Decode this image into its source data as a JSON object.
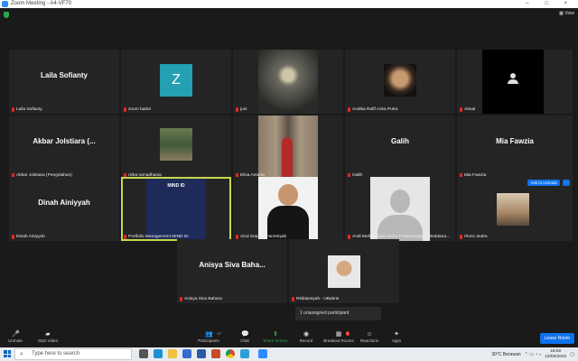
{
  "window": {
    "title": "Zoom Meeting - A4-VF70",
    "controls": "–  □  ×"
  },
  "meeting": {
    "view_label": "▦ View"
  },
  "tiles": [
    {
      "name": "Laila Sofianty",
      "caption": "Laila Sofianty"
    },
    {
      "caption": "zoom bat04",
      "avatar_letter": "Z"
    },
    {
      "caption": "juni"
    },
    {
      "caption": "Andika Rafif Azka Putra"
    },
    {
      "caption": "Atmal"
    },
    {
      "name": "Akbar Jolstiara (...",
      "caption": "Akbar Jolstiara (Pengolahan)"
    },
    {
      "caption": "rizka ramadhania"
    },
    {
      "caption": "Elisa Antarta"
    },
    {
      "name": "Galih",
      "caption": "Galih"
    },
    {
      "name": "Mia Fawzia",
      "caption": "Mia Fawzia"
    },
    {
      "name": "Dinah Ainiyyah",
      "caption": "Dinah Ainiyyah"
    },
    {
      "caption": "Portfolio Management MIND ID",
      "logo_text": "MIND ID"
    },
    {
      "caption": "Airul Septian Faronsyah"
    },
    {
      "caption": "Andi Muhammad Andra Prawiranegara Meddana..."
    },
    {
      "caption": "rhoric andra",
      "ask_label": "Ask to Unmute",
      "more_label": "···"
    },
    {
      "name": "Anisya Siva Baha...",
      "caption": "Anisya Siva Bahara"
    },
    {
      "caption": "Risbiansyah - UBakrie"
    }
  ],
  "unassigned": "1 unassigned participant",
  "toolbar": {
    "unmute": "Unmute",
    "start_video": "Start Video",
    "participants": "Participants",
    "participants_count": "17",
    "chat": "Chat",
    "share": "Share Screen",
    "record": "Record",
    "breakout": "Breakout Rooms",
    "reactions": "Reactions",
    "apps": "Apps",
    "badge": "1",
    "leave": "Leave Room"
  },
  "taskbar": {
    "search_placeholder": "Type here to search",
    "weather": "30°C  Berawan",
    "time": "18:50",
    "date": "10/05/2022"
  },
  "colors": {
    "accent": "#0e72ed",
    "highlight": "#c8d84a",
    "muted_mic": "#e02828",
    "share_green": "#2da44e"
  }
}
